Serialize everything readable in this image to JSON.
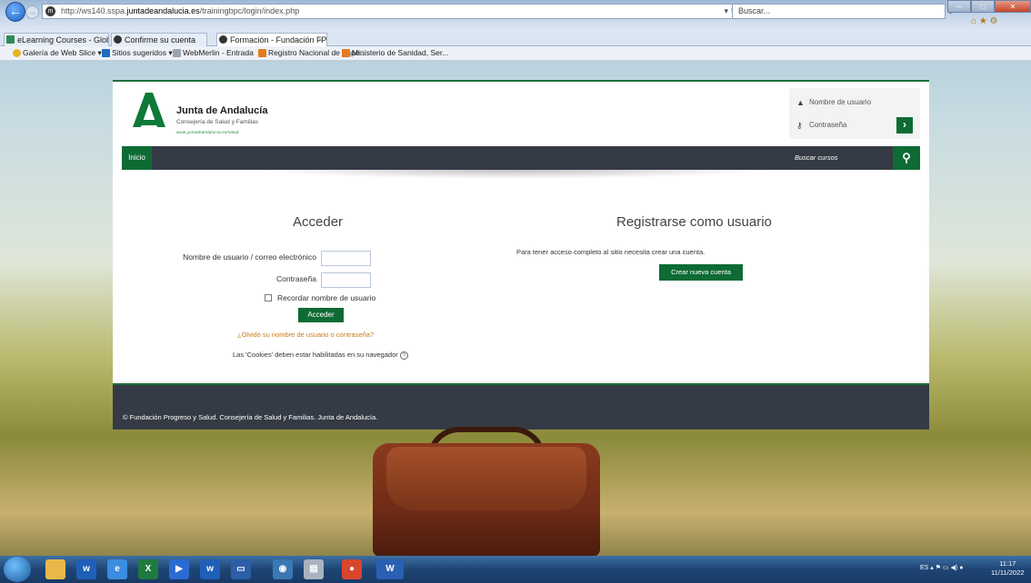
{
  "browser": {
    "url_prefix": "http://ws140.sspa.",
    "url_host": "juntadeandalucia.es",
    "url_path": "/trainingbpc/login/index.php",
    "search_placeholder": "Buscar...",
    "tabs": [
      {
        "label": "eLearning Courses - Global He..."
      },
      {
        "label": "Confirme su cuenta"
      },
      {
        "label": "Formación - Fundación FPS..."
      }
    ],
    "favorites": [
      {
        "label": "Galería de Web Slice ▾"
      },
      {
        "label": "Sitios sugeridos ▾"
      },
      {
        "label": "WebMerlin - Entrada"
      },
      {
        "label": "Registro Nacional de Espe..."
      },
      {
        "label": "Ministerio de Sanidad, Ser..."
      }
    ]
  },
  "header": {
    "org_name": "Junta de Andalucía",
    "org_sub": "Consejería de Salud y Familias",
    "org_url": "www.juntadeandalucia.es/salud",
    "username_placeholder": "Nombre de usuario",
    "password_placeholder": "Contraseña"
  },
  "nav": {
    "home": "Inicio",
    "search_label": "Buscar cursos"
  },
  "login": {
    "heading": "Acceder",
    "username_label": "Nombre de usuario / correo electrónico",
    "password_label": "Contraseña",
    "remember_label": "Recordar nombre de usuario",
    "submit": "Acceder",
    "forgot": "¿Olvidó su nombre de usuario o contraseña?",
    "cookies": "Las 'Cookies' deben estar habilitadas en su navegador"
  },
  "register": {
    "heading": "Registrarse como usuario",
    "text": "Para tener acceso completo al sitio necesita crear una cuenta.",
    "button": "Crear nueva cuenta"
  },
  "footer": {
    "text": "© Fundación Progreso y Salud. Consejería de Salud y Familias. Junta de Andalucía."
  },
  "taskbar": {
    "lang": "ES",
    "time": "11:17",
    "date": "11/11/2022"
  },
  "colors": {
    "brand_green": "#0e6b34",
    "nav_dark": "#353b45",
    "link_orange": "#c97a1a"
  }
}
